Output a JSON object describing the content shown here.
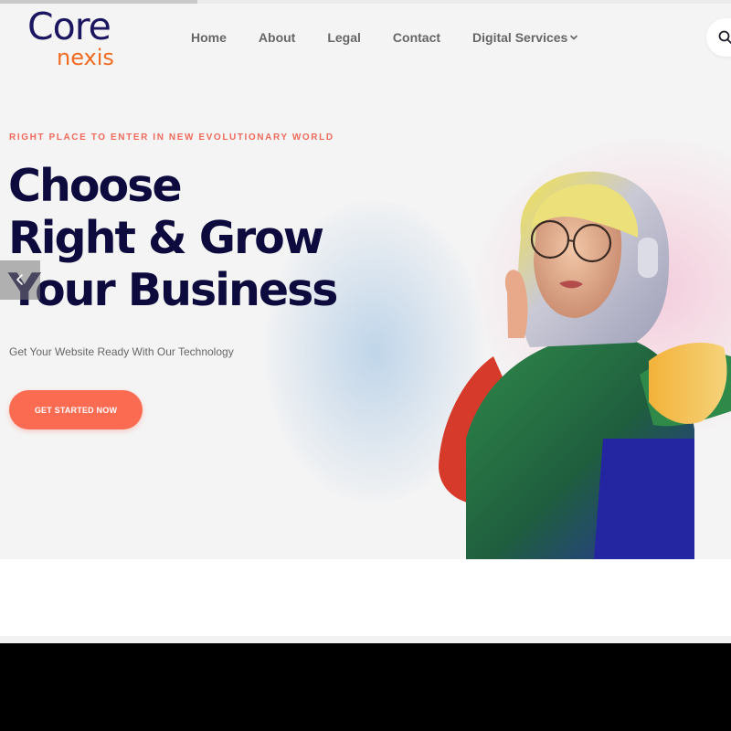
{
  "brand": {
    "core": "Core",
    "nexis": "nexis"
  },
  "colors": {
    "brand_navy": "#1b1660",
    "brand_orange": "#f26b21",
    "accent": "#fb6b52",
    "kicker": "#ef6a5b",
    "headline": "#0d0b3e"
  },
  "nav": {
    "items": [
      {
        "label": "Home"
      },
      {
        "label": "About"
      },
      {
        "label": "Legal"
      },
      {
        "label": "Contact"
      },
      {
        "label": "Digital Services"
      }
    ]
  },
  "icons": {
    "search": "search-icon",
    "dropdown": "chevron-down-icon",
    "prev": "chevron-left-icon"
  },
  "hero": {
    "kicker": "RIGHT PLACE TO ENTER IN NEW EVOLUTIONARY WORLD",
    "headline_lines": [
      "Choose",
      "Right & Grow",
      "Your Business"
    ],
    "subtext": "Get Your Website Ready With Our Technology",
    "cta_label": "GET STARTED NOW"
  },
  "slider_progress": 0.27
}
